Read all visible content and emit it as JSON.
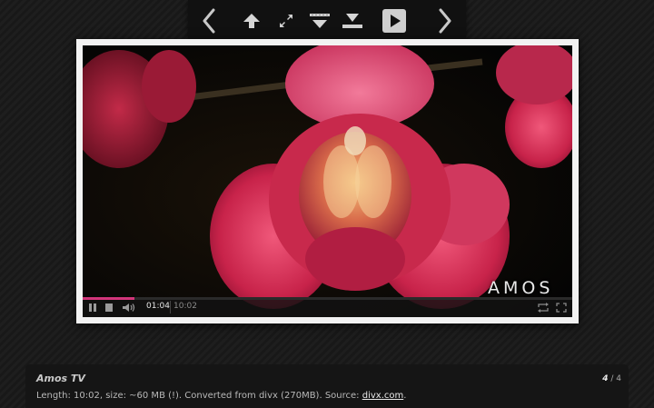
{
  "toolbar": {
    "buttons": [
      {
        "icon": "chevron-left-icon"
      },
      {
        "icon": "arrow-up-icon"
      },
      {
        "icon": "fullscreen-arrows-icon"
      },
      {
        "icon": "expand-down-icon"
      },
      {
        "icon": "collapse-down-icon"
      },
      {
        "icon": "play-icon"
      },
      {
        "icon": "chevron-right-icon"
      }
    ]
  },
  "video": {
    "watermark": "AMOS",
    "progress": 0.105,
    "accent_color": "#d2357a",
    "current_time": "01:04",
    "total_time": "10:02",
    "controls": {
      "left": [
        "pause-icon",
        "stop-icon",
        "volume-icon"
      ],
      "right": [
        "loop-icon",
        "fullscreen-icon"
      ]
    }
  },
  "caption": {
    "title": "Amos TV",
    "description_text": "Length: 10:02, size: ~60 MB (!). Converted from divx (270MB). Source:",
    "source_link": "divx.com",
    "trailing": ".",
    "counter_current": "4",
    "counter_sep": " / ",
    "counter_total": "4"
  }
}
